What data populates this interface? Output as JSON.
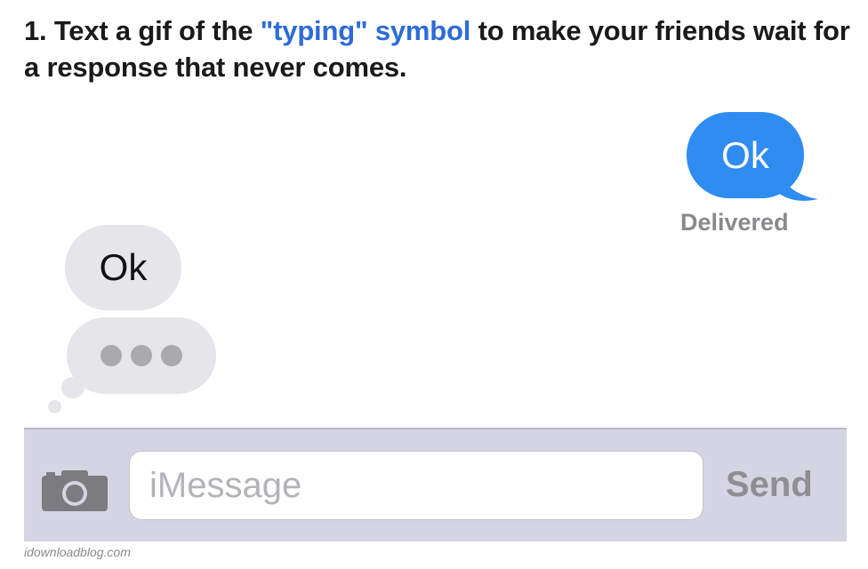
{
  "headline": {
    "prefix": "1. Text a gif of the ",
    "link_text": "\"typing\" symbol",
    "suffix": " to make your friends wait for a response that never comes."
  },
  "conversation": {
    "outgoing_message": "Ok",
    "delivery_status": "Delivered",
    "incoming_message": "Ok",
    "typing_indicator_dots": 3
  },
  "input_bar": {
    "placeholder": "iMessage",
    "send_label": "Send",
    "camera_icon": "camera-icon"
  },
  "credit": "idownloadblog.com",
  "colors": {
    "link": "#2e6bd6",
    "outgoing_bubble": "#2f8cf0",
    "incoming_bubble": "#e5e5ea",
    "input_bar": "#d4d4e2"
  }
}
